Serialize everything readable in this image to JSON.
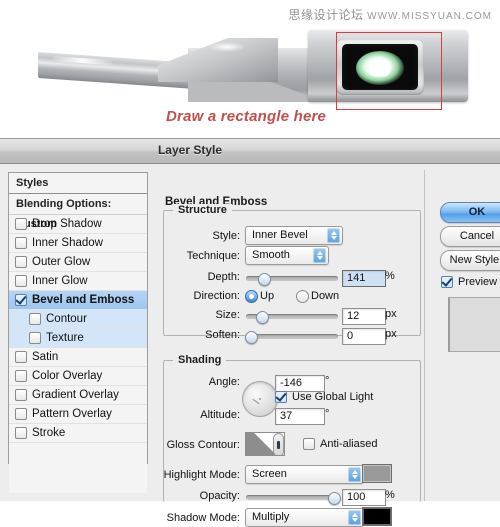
{
  "photo": {
    "watermark_cn": "思缘设计论坛",
    "watermark_url": "WWW.MISSYUAN.COM",
    "caption": "Draw a rectangle here",
    "annotation_color": "#e03a3a",
    "caption_color": "#c0504d",
    "device_name": "metallic-device-sensor"
  },
  "dialog": {
    "title": "Layer Style",
    "styles": {
      "header": "Styles",
      "blending_options": "Blending Options: Custom",
      "items": [
        {
          "label": "Drop Shadow",
          "checked": false,
          "selected": false,
          "sub": false
        },
        {
          "label": "Inner Shadow",
          "checked": false,
          "selected": false,
          "sub": false
        },
        {
          "label": "Outer Glow",
          "checked": false,
          "selected": false,
          "sub": false
        },
        {
          "label": "Inner Glow",
          "checked": false,
          "selected": false,
          "sub": false
        },
        {
          "label": "Bevel and Emboss",
          "checked": true,
          "selected": true,
          "sub": false
        },
        {
          "label": "Contour",
          "checked": false,
          "selected": false,
          "sub": true
        },
        {
          "label": "Texture",
          "checked": false,
          "selected": false,
          "sub": true
        },
        {
          "label": "Satin",
          "checked": false,
          "selected": false,
          "sub": false
        },
        {
          "label": "Color Overlay",
          "checked": false,
          "selected": false,
          "sub": false
        },
        {
          "label": "Gradient Overlay",
          "checked": false,
          "selected": false,
          "sub": false
        },
        {
          "label": "Pattern Overlay",
          "checked": false,
          "selected": false,
          "sub": false
        },
        {
          "label": "Stroke",
          "checked": false,
          "selected": false,
          "sub": false
        }
      ]
    },
    "panel": {
      "title": "Bevel and Emboss",
      "structure": {
        "legend": "Structure",
        "style_label": "Style:",
        "style_value": "Inner Bevel",
        "technique_label": "Technique:",
        "technique_value": "Smooth",
        "depth_label": "Depth:",
        "depth_value": "141",
        "depth_unit": "%",
        "direction_label": "Direction:",
        "direction_up": "Up",
        "direction_down": "Down",
        "direction_selected": "Up",
        "size_label": "Size:",
        "size_value": "12",
        "size_unit": "px",
        "soften_label": "Soften:",
        "soften_value": "0",
        "soften_unit": "px"
      },
      "shading": {
        "legend": "Shading",
        "angle_label": "Angle:",
        "angle_value": "-146",
        "angle_unit": "°",
        "use_global_light": "Use Global Light",
        "use_global_light_checked": true,
        "altitude_label": "Altitude:",
        "altitude_value": "37",
        "altitude_unit": "°",
        "gloss_contour_label": "Gloss Contour:",
        "anti_aliased": "Anti-aliased",
        "anti_aliased_checked": false,
        "highlight_mode_label": "Highlight Mode:",
        "highlight_mode_value": "Screen",
        "highlight_color": "#9a9a9a",
        "opacity_label": "Opacity:",
        "opacity_value": "100",
        "opacity_unit": "%",
        "shadow_mode_label": "Shadow Mode:",
        "shadow_mode_value": "Multiply",
        "shadow_color": "#000000"
      }
    },
    "buttons": {
      "ok": "OK",
      "cancel": "Cancel",
      "new_style": "New Style...",
      "preview": "Preview",
      "preview_checked": true
    }
  }
}
